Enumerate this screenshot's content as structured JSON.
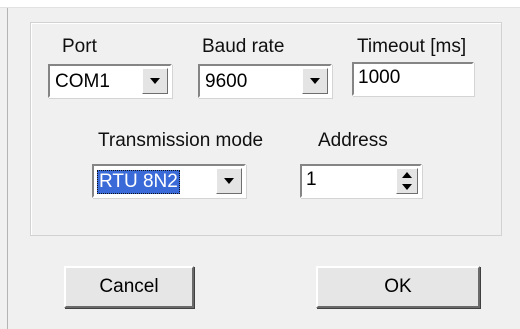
{
  "serial": {
    "port": {
      "label": "Port",
      "value": "COM1"
    },
    "baud_rate": {
      "label": "Baud rate",
      "value": "9600"
    },
    "timeout": {
      "label": "Timeout [ms]",
      "value": "1000"
    },
    "transmission_mode": {
      "label": "Transmission mode",
      "value": "RTU 8N2"
    },
    "address": {
      "label": "Address",
      "value": "1"
    }
  },
  "buttons": {
    "cancel": "Cancel",
    "ok": "OK"
  }
}
